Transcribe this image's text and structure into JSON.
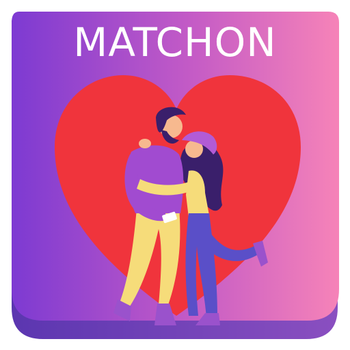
{
  "app_icon": {
    "title": "MATCHON",
    "colors": {
      "gradient_start": "#7c3ad0",
      "gradient_end": "#f47fb8",
      "base_shadow": "#6d3fb3",
      "heart": "#f0343c",
      "man_shirt": "#a14bd0",
      "man_pants": "#f6dc7a",
      "woman_top": "#f6dc7a",
      "woman_pants": "#5a4fc8",
      "hat": "#b25bd6",
      "hair": "#3a1f6b",
      "skin": "#f7b98f"
    },
    "illustration": "couple-hugging-in-front-of-heart"
  }
}
